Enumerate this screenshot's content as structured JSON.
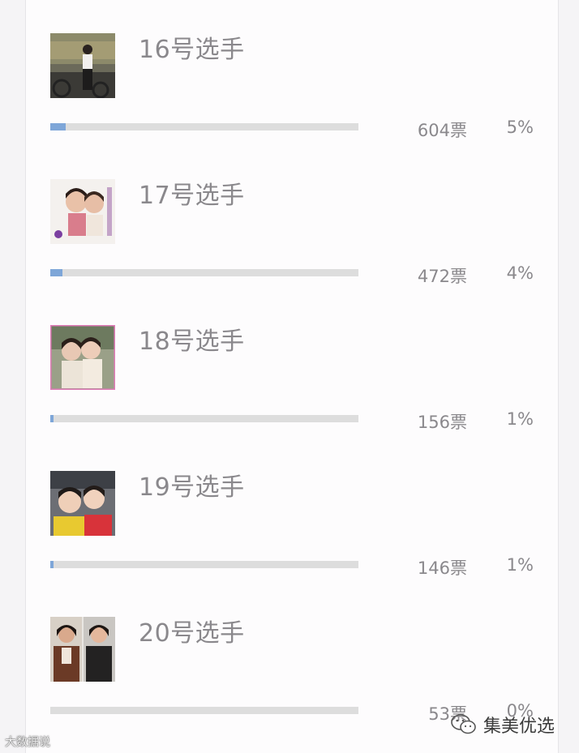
{
  "entries": [
    {
      "name": "16号选手",
      "votes": "604票",
      "percent": "5%",
      "share": 0.05,
      "photo": "contestant-16-photo"
    },
    {
      "name": "17号选手",
      "votes": "472票",
      "percent": "4%",
      "share": 0.04,
      "photo": "contestant-17-photo"
    },
    {
      "name": "18号选手",
      "votes": "156票",
      "percent": "1%",
      "share": 0.01,
      "photo": "contestant-18-photo"
    },
    {
      "name": "19号选手",
      "votes": "146票",
      "percent": "1%",
      "share": 0.01,
      "photo": "contestant-19-photo"
    },
    {
      "name": "20号选手",
      "votes": "53票",
      "percent": "0%",
      "share": 0.0,
      "photo": "contestant-20-photo"
    }
  ],
  "colors": {
    "bar_fill": "#7ea6d8",
    "bar_track": "#dddddd",
    "text": "#8a888c"
  },
  "watermarks": {
    "left": "大数据说",
    "right": "集美优选"
  }
}
